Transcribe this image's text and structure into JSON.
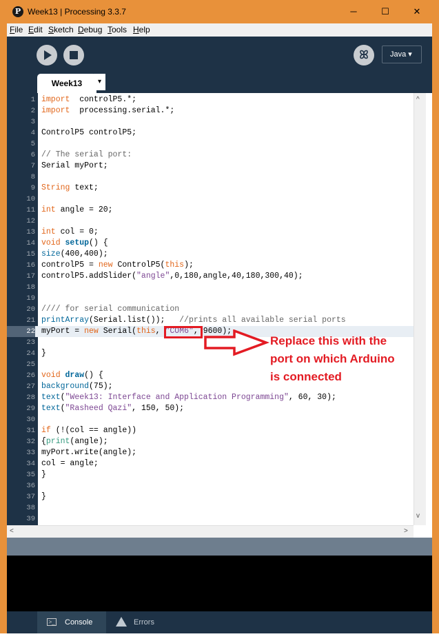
{
  "window": {
    "title": "Week13 | Processing 3.3.7",
    "controls": {
      "minimize": "─",
      "maximize": "☐",
      "close": "✕"
    }
  },
  "menu": [
    "File",
    "Edit",
    "Sketch",
    "Debug",
    "Tools",
    "Help"
  ],
  "toolbar": {
    "run_icon": "play-icon",
    "stop_icon": "stop-icon",
    "debugger_icon": "butterfly-icon",
    "mode": "Java ▾"
  },
  "tabs": {
    "active": "Week13",
    "menu_glyph": "▾"
  },
  "editor": {
    "highlighted_line": 22,
    "lines": [
      {
        "n": "1",
        "tokens": [
          [
            "k1",
            "import"
          ],
          [
            "",
            "  controlP5.*;"
          ]
        ]
      },
      {
        "n": "2",
        "tokens": [
          [
            "k1",
            "import"
          ],
          [
            "",
            "  processing.serial.*;"
          ]
        ]
      },
      {
        "n": "3",
        "tokens": []
      },
      {
        "n": "4",
        "tokens": [
          [
            "",
            "ControlP5 controlP5;"
          ]
        ]
      },
      {
        "n": "5",
        "tokens": []
      },
      {
        "n": "6",
        "tokens": [
          [
            "cm",
            "// The serial port:"
          ]
        ]
      },
      {
        "n": "7",
        "tokens": [
          [
            "",
            "Serial myPort;"
          ]
        ]
      },
      {
        "n": "8",
        "tokens": []
      },
      {
        "n": "9",
        "tokens": [
          [
            "k1",
            "String"
          ],
          [
            "",
            " text;"
          ]
        ]
      },
      {
        "n": "10",
        "tokens": []
      },
      {
        "n": "11",
        "tokens": [
          [
            "k1",
            "int"
          ],
          [
            "",
            " angle = 20;"
          ]
        ]
      },
      {
        "n": "12",
        "tokens": []
      },
      {
        "n": "13",
        "tokens": [
          [
            "k1",
            "int"
          ],
          [
            "",
            " col = 0;"
          ]
        ]
      },
      {
        "n": "14",
        "tokens": [
          [
            "k1",
            "void"
          ],
          [
            "",
            " "
          ],
          [
            "fnb",
            "setup"
          ],
          [
            "",
            "() {"
          ]
        ]
      },
      {
        "n": "15",
        "tokens": [
          [
            "fn",
            "size"
          ],
          [
            "",
            "(400,400);"
          ]
        ]
      },
      {
        "n": "16",
        "tokens": [
          [
            "",
            "controlP5 = "
          ],
          [
            "k1",
            "new"
          ],
          [
            "",
            " ControlP5("
          ],
          [
            "k1",
            "this"
          ],
          [
            "",
            ");"
          ]
        ]
      },
      {
        "n": "17",
        "tokens": [
          [
            "",
            "controlP5.addSlider("
          ],
          [
            "str",
            "\"angle\""
          ],
          [
            "",
            ",0,180,angle,40,180,300,40);"
          ]
        ]
      },
      {
        "n": "18",
        "tokens": []
      },
      {
        "n": "19",
        "tokens": []
      },
      {
        "n": "20",
        "tokens": [
          [
            "cm",
            "//// for serial communication"
          ]
        ]
      },
      {
        "n": "21",
        "tokens": [
          [
            "fn",
            "printArray"
          ],
          [
            "",
            "(Serial.list());   "
          ],
          [
            "cm",
            "//prints all available serial ports"
          ]
        ]
      },
      {
        "n": "22",
        "tokens": [
          [
            "",
            "myPort = "
          ],
          [
            "k1",
            "new"
          ],
          [
            "",
            " Serial("
          ],
          [
            "k1",
            "this"
          ],
          [
            "",
            ", "
          ],
          [
            "str",
            "\"COM6\""
          ],
          [
            "",
            ", 9600);"
          ]
        ]
      },
      {
        "n": "23",
        "tokens": []
      },
      {
        "n": "24",
        "tokens": [
          [
            "",
            "}"
          ]
        ]
      },
      {
        "n": "25",
        "tokens": []
      },
      {
        "n": "26",
        "tokens": [
          [
            "k1",
            "void"
          ],
          [
            "",
            " "
          ],
          [
            "fnb",
            "draw"
          ],
          [
            "",
            "() {"
          ]
        ]
      },
      {
        "n": "27",
        "tokens": [
          [
            "fn",
            "background"
          ],
          [
            "",
            "(75);"
          ]
        ]
      },
      {
        "n": "28",
        "tokens": [
          [
            "fn",
            "text"
          ],
          [
            "",
            "("
          ],
          [
            "str",
            "\"Week13: Interface and Application Programming\""
          ],
          [
            "",
            ", 60, 30);"
          ]
        ]
      },
      {
        "n": "29",
        "tokens": [
          [
            "fn",
            "text"
          ],
          [
            "",
            "("
          ],
          [
            "str",
            "\"Rasheed Qazi\""
          ],
          [
            "",
            ", 150, 50);"
          ]
        ]
      },
      {
        "n": "30",
        "tokens": []
      },
      {
        "n": "31",
        "tokens": [
          [
            "k1",
            "if"
          ],
          [
            "",
            " (!(col == angle))"
          ]
        ]
      },
      {
        "n": "32",
        "tokens": [
          [
            "",
            "{"
          ],
          [
            "k2",
            "print"
          ],
          [
            "",
            "(angle);"
          ]
        ]
      },
      {
        "n": "33",
        "tokens": [
          [
            "",
            "myPort.write(angle);"
          ]
        ]
      },
      {
        "n": "34",
        "tokens": [
          [
            "",
            "col = angle;"
          ]
        ]
      },
      {
        "n": "35",
        "tokens": [
          [
            "",
            "}"
          ]
        ]
      },
      {
        "n": "36",
        "tokens": []
      },
      {
        "n": "37",
        "tokens": [
          [
            "",
            "}"
          ]
        ]
      },
      {
        "n": "38",
        "tokens": []
      },
      {
        "n": "39",
        "tokens": []
      }
    ]
  },
  "annotation": {
    "text": "Replace this with the\nport on which Arduino\nis connected",
    "color": "#e31b23"
  },
  "bottom_tabs": {
    "console": "Console",
    "errors": "Errors"
  },
  "colors": {
    "window_frame": "#e8913a",
    "toolbar_bg": "#1e3246",
    "keyword": "#e2661a",
    "function": "#006699",
    "string": "#7d4793",
    "comment": "#666666"
  }
}
